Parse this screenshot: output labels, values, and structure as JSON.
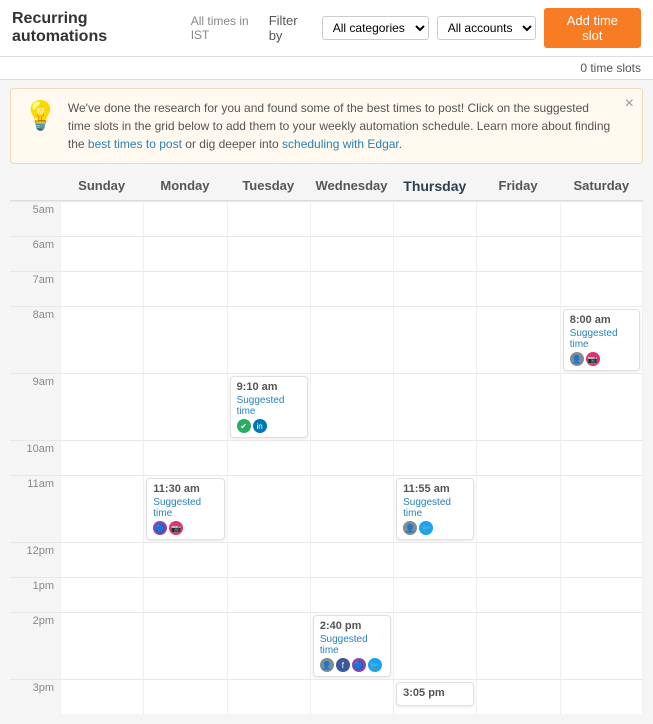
{
  "header": {
    "title": "Recurring automations",
    "subtitle": "All times in IST",
    "filter_label": "Filter by",
    "category_placeholder": "All categories",
    "account_placeholder": "All accounts",
    "add_button": "Add time slot",
    "slots_count": "0 time slots"
  },
  "banner": {
    "text_main": "We've done the research for you and found some of the best times to post! Click on the suggested time slots in the grid below to add them to your weekly automation schedule. Learn more about finding the ",
    "link_best_times": "best times to post",
    "text_middle": " or dig deeper into ",
    "link_scheduling": "scheduling with Edgar",
    "text_end": "."
  },
  "days": {
    "labels": [
      "Sunday",
      "Monday",
      "Tuesday",
      "Wednesday",
      "Thursday",
      "Friday",
      "Saturday"
    ]
  },
  "time_slots": [
    {
      "time": "5am"
    },
    {
      "time": "6am"
    },
    {
      "time": "7am"
    },
    {
      "time": "8am"
    },
    {
      "time": "9am"
    },
    {
      "time": "10am"
    },
    {
      "time": "11am"
    },
    {
      "time": "12pm"
    },
    {
      "time": "1pm"
    },
    {
      "time": "2pm"
    },
    {
      "time": "3pm"
    }
  ],
  "suggested_slots": [
    {
      "day": 6,
      "row": 3,
      "time": "8:00 am",
      "label": "Suggested time",
      "icons": [
        "user",
        "ig"
      ]
    },
    {
      "day": 2,
      "row": 4,
      "time": "9:10 am",
      "label": "Suggested time",
      "icons": [
        "green",
        "li"
      ]
    },
    {
      "day": 1,
      "row": 6,
      "time": "11:30 am",
      "label": "Suggested time",
      "icons": [
        "multi",
        "ig"
      ]
    },
    {
      "day": 4,
      "row": 7,
      "time": "11:55 am",
      "label": "Suggested time",
      "icons": [
        "user",
        "tw"
      ]
    },
    {
      "day": 3,
      "row": 9,
      "time": "2:40 pm",
      "label": "Suggested time",
      "icons": [
        "user",
        "fb",
        "multi",
        "tw"
      ]
    },
    {
      "day": 4,
      "row": 10,
      "time": "3:05 pm",
      "label": "",
      "icons": []
    }
  ],
  "labels": {
    "suggested": "Suggested time"
  }
}
